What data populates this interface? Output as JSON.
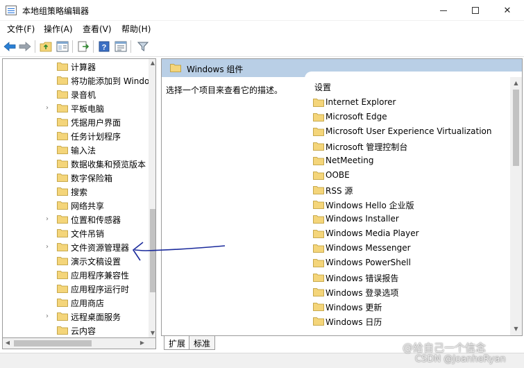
{
  "window": {
    "title": "本地组策略编辑器",
    "min_glyph": "",
    "max_glyph": "",
    "close_glyph": "✕"
  },
  "menu": [
    "文件(F)",
    "操作(A)",
    "查看(V)",
    "帮助(H)"
  ],
  "toolbar": {
    "buttons": [
      "back-arrow-icon",
      "forward-arrow-icon",
      "up-folder-icon",
      "show-hide-tree-icon",
      "export-list-icon",
      "help-icon",
      "properties-icon",
      "filter-icon"
    ]
  },
  "tree": {
    "items": [
      {
        "label": "计算器",
        "expandable": false
      },
      {
        "label": "将功能添加到 Windo",
        "expandable": false
      },
      {
        "label": "录音机",
        "expandable": false
      },
      {
        "label": "平板电脑",
        "expandable": true
      },
      {
        "label": "凭据用户界面",
        "expandable": false
      },
      {
        "label": "任务计划程序",
        "expandable": false
      },
      {
        "label": "输入法",
        "expandable": false
      },
      {
        "label": "数据收集和预览版本",
        "expandable": false
      },
      {
        "label": "数字保险箱",
        "expandable": false
      },
      {
        "label": "搜索",
        "expandable": false
      },
      {
        "label": "网络共享",
        "expandable": false
      },
      {
        "label": "位置和传感器",
        "expandable": true
      },
      {
        "label": "文件吊销",
        "expandable": false
      },
      {
        "label": "文件资源管理器",
        "expandable": true
      },
      {
        "label": "演示文稿设置",
        "expandable": false
      },
      {
        "label": "应用程序兼容性",
        "expandable": false
      },
      {
        "label": "应用程序运行时",
        "expandable": false
      },
      {
        "label": "应用商店",
        "expandable": false
      },
      {
        "label": "远程桌面服务",
        "expandable": true
      },
      {
        "label": "云内容",
        "expandable": false
      }
    ],
    "expander_glyph": "›",
    "scroll_up": "▲",
    "scroll_down": "▼",
    "scroll_left": "◀",
    "scroll_right": "▶"
  },
  "right_pane": {
    "header": "Windows 组件",
    "description": "选择一个项目来查看它的描述。",
    "column_header": "设置",
    "items": [
      "Internet Explorer",
      "Microsoft Edge",
      "Microsoft User Experience Virtualization",
      "Microsoft 管理控制台",
      "NetMeeting",
      "OOBE",
      "RSS 源",
      "Windows Hello 企业版",
      "Windows Installer",
      "Windows Media Player",
      "Windows Messenger",
      "Windows PowerShell",
      "Windows 错误报告",
      "Windows 登录选项",
      "Windows 更新",
      "Windows 日历"
    ],
    "scroll_up": "▲",
    "scroll_down": "▼"
  },
  "tabs": {
    "extended": "扩展",
    "standard": "标准"
  },
  "watermark": {
    "line1": "@给自己一个信念",
    "line2": "CSDN @JoanheRyan"
  },
  "colors": {
    "header_bg": "#b9cfe6",
    "folder_fill": "#f4d57a",
    "annotation_ink": "#1a2a9c"
  }
}
